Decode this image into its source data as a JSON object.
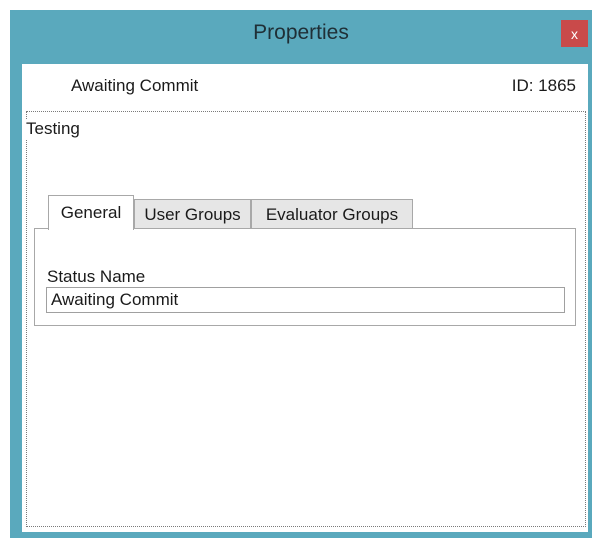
{
  "window": {
    "title": "Properties",
    "close_label": "x"
  },
  "header": {
    "status": "Awaiting Commit",
    "id_label": "ID: 1865"
  },
  "group": {
    "label": "Testing"
  },
  "tabs": [
    {
      "label": "General",
      "active": true
    },
    {
      "label": "User Groups",
      "active": false
    },
    {
      "label": "Evaluator Groups",
      "active": false
    }
  ],
  "general": {
    "status_name_label": "Status Name",
    "status_name_value": "Awaiting Commit"
  },
  "colors": {
    "window_frame": "#5aa9bd",
    "close_button": "#c94a4a"
  }
}
